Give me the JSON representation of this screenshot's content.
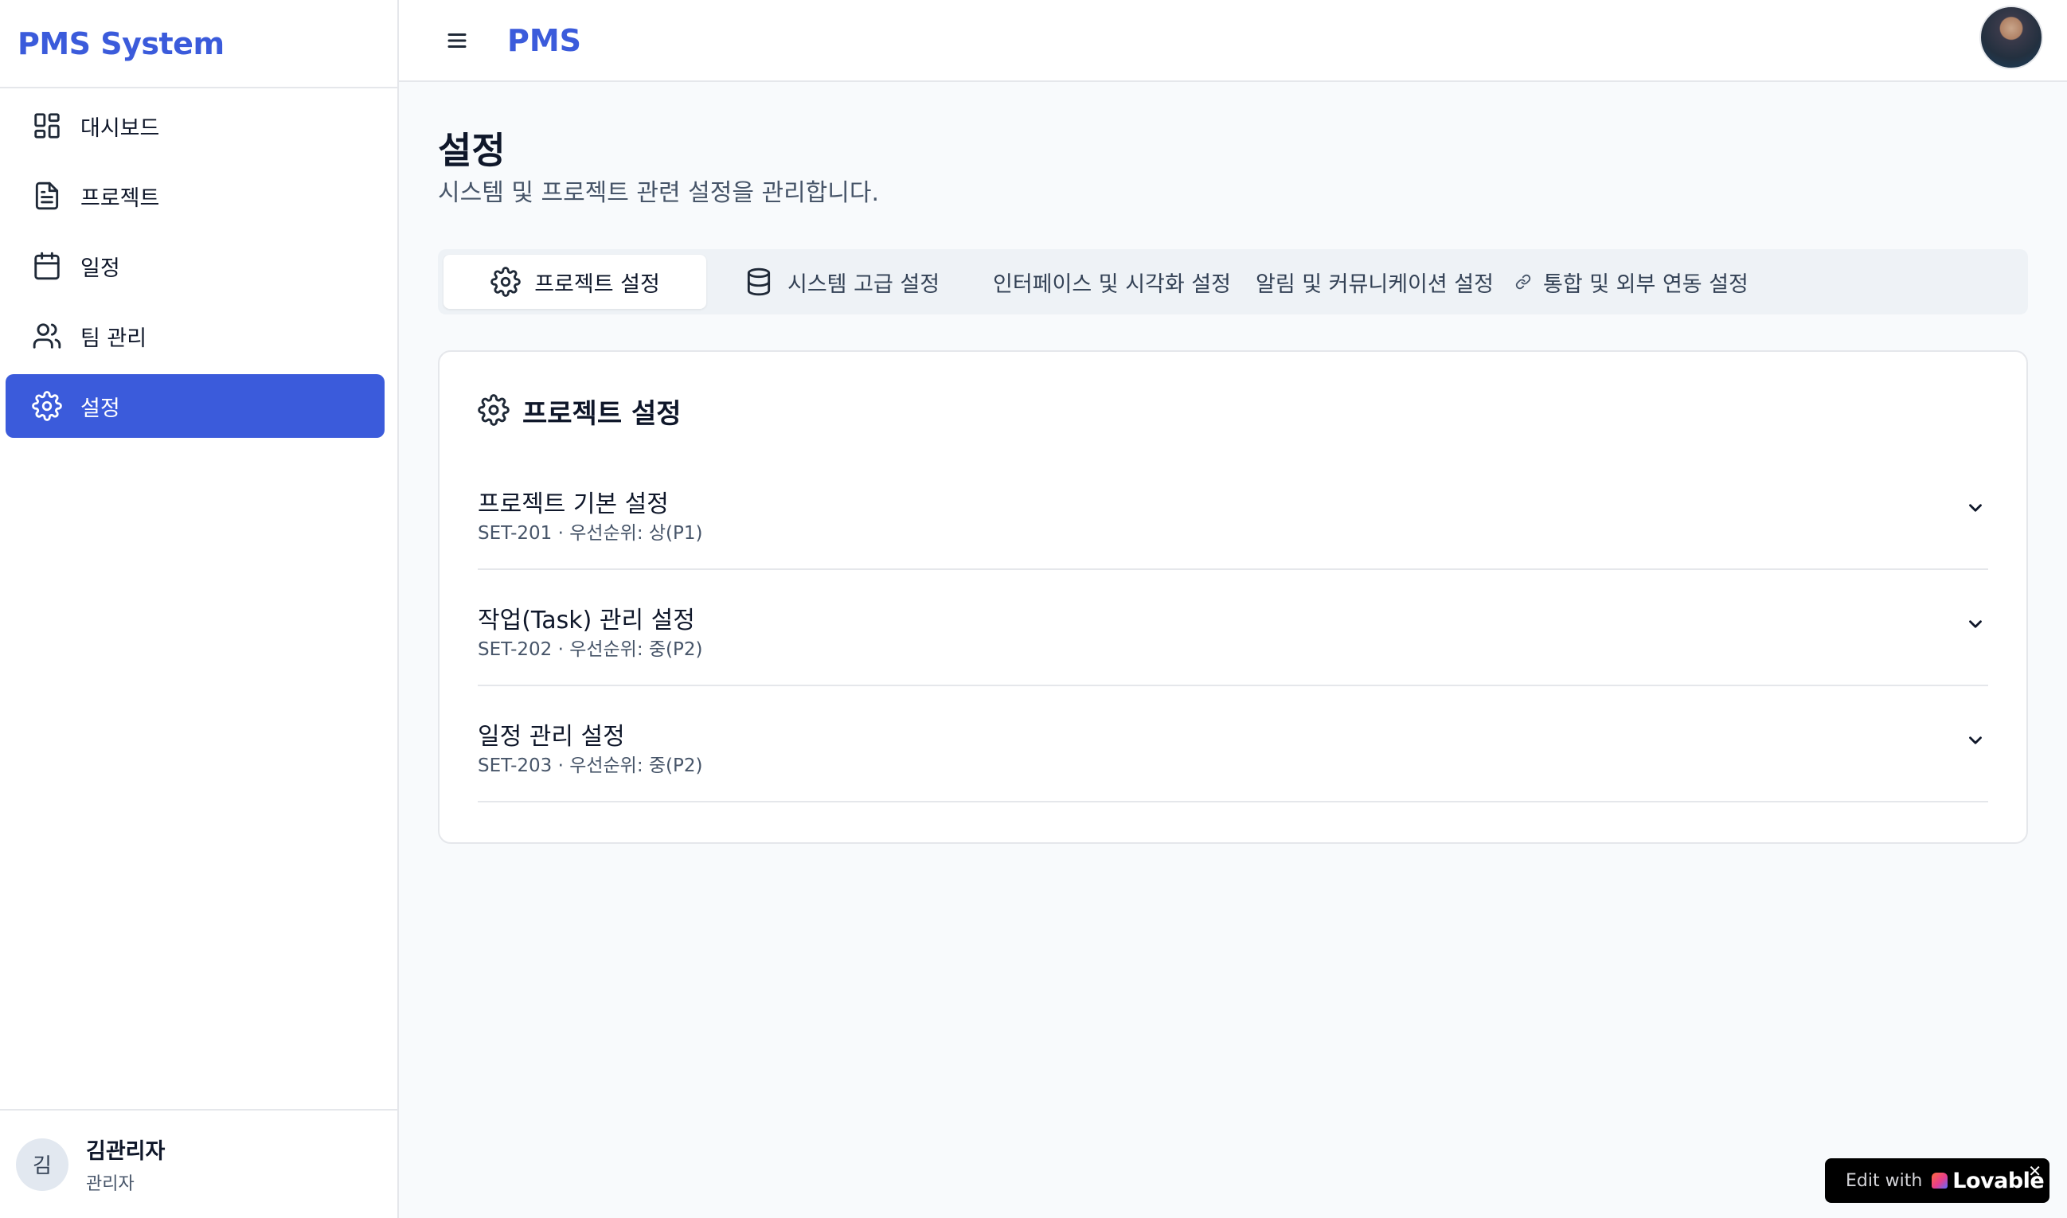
{
  "sidebar": {
    "brand": "PMS System",
    "items": [
      {
        "label": "대시보드",
        "icon": "dashboard-icon"
      },
      {
        "label": "프로젝트",
        "icon": "document-icon"
      },
      {
        "label": "일정",
        "icon": "calendar-icon"
      },
      {
        "label": "팀 관리",
        "icon": "users-icon"
      },
      {
        "label": "설정",
        "icon": "gear-icon",
        "active": true
      }
    ],
    "user": {
      "initial": "김",
      "name": "김관리자",
      "role": "관리자"
    }
  },
  "header": {
    "title": "PMS",
    "menu_icon": "hamburger-menu-icon",
    "profile_icon": "profile-avatar"
  },
  "page": {
    "title": "설정",
    "subtitle": "시스템 및 프로젝트 관련 설정을 관리합니다."
  },
  "tabs": [
    {
      "label": "프로젝트 설정",
      "icon": "gear-icon",
      "active": true
    },
    {
      "label": "시스템 고급 설정",
      "icon": "database-icon"
    },
    {
      "label": "인터페이스 및 시각화 설정"
    },
    {
      "label": "알림 및 커뮤니케이션 설정"
    },
    {
      "label": "통합 및 외부 연동 설정",
      "icon": "link-icon"
    }
  ],
  "card": {
    "title": "프로젝트 설정",
    "icon": "gear-icon",
    "items": [
      {
        "title": "프로젝트 기본 설정",
        "meta": "SET-201 · 우선순위: 상(P1)"
      },
      {
        "title": "작업(Task) 관리 설정",
        "meta": "SET-202 · 우선순위: 중(P2)"
      },
      {
        "title": "일정 관리 설정",
        "meta": "SET-203 · 우선순위: 중(P2)"
      }
    ]
  },
  "badge": {
    "edit": "Edit with",
    "brand": "Lovable",
    "close": "✕"
  },
  "colors": {
    "accent": "#3b5bdb",
    "background": "#f8fafc",
    "border": "#e5e7eb"
  }
}
